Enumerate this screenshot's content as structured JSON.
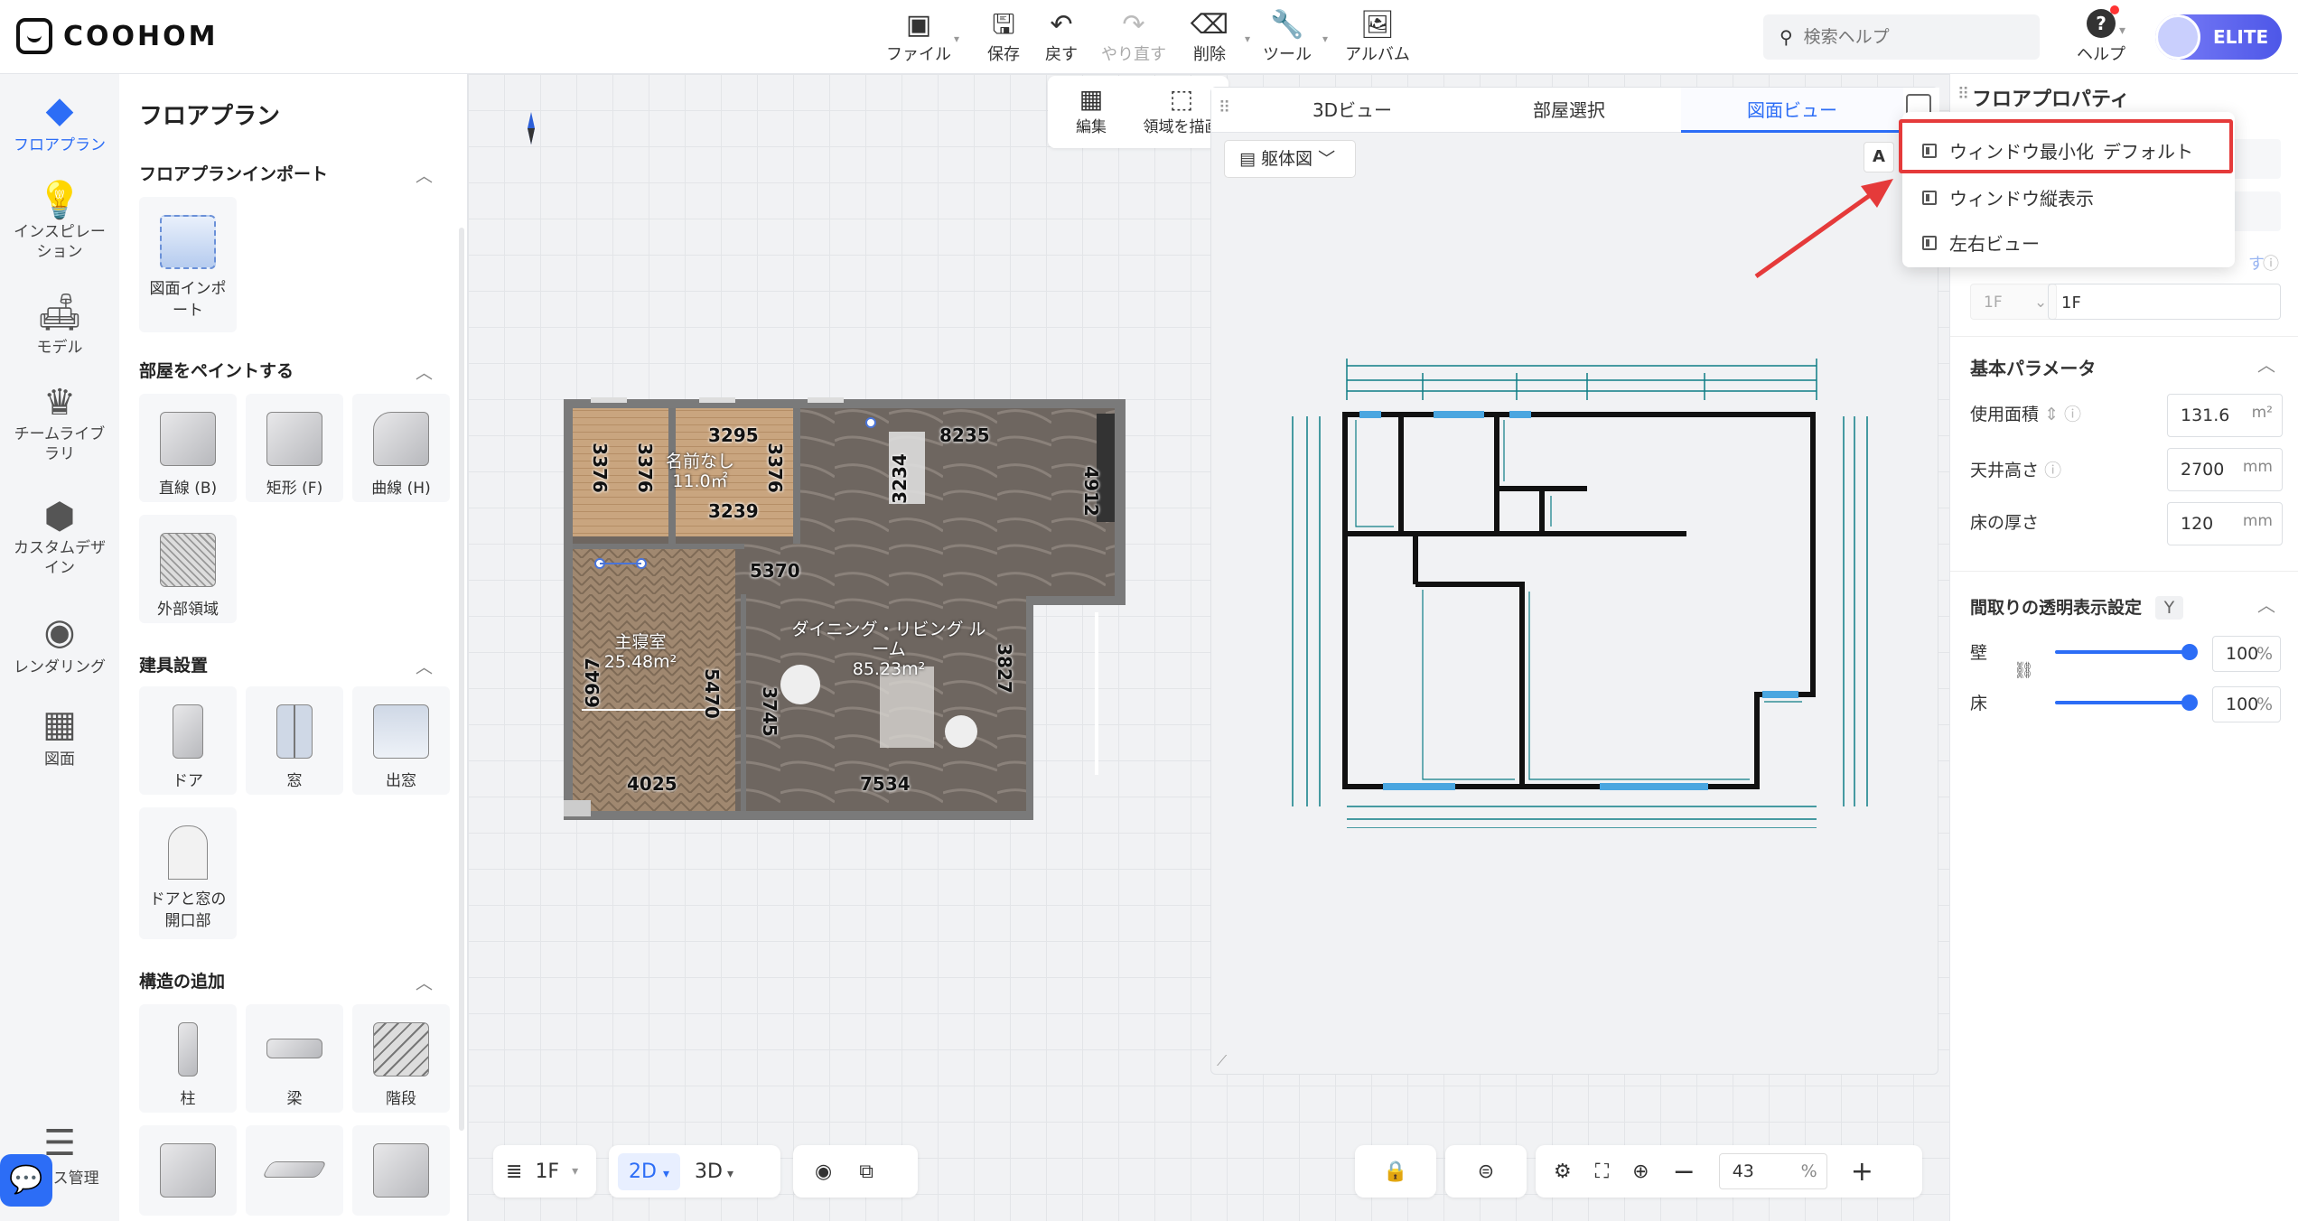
{
  "app": {
    "logo": "COOHOM",
    "badge": "ELITE"
  },
  "toolbar": [
    {
      "label": "ファイル",
      "icon": "file-icon",
      "has_caret": true
    },
    {
      "label": "保存",
      "icon": "save-icon"
    },
    {
      "label": "戻す",
      "icon": "undo-icon"
    },
    {
      "label": "やり直す",
      "icon": "redo-icon",
      "disabled": true
    },
    {
      "label": "削除",
      "icon": "eraser-icon",
      "has_caret": true
    },
    {
      "label": "ツール",
      "icon": "wrench-icon",
      "has_caret": true
    },
    {
      "label": "アルバム",
      "icon": "album-icon"
    }
  ],
  "search": {
    "placeholder": "検索ヘルプ"
  },
  "help_label": "ヘルプ",
  "leftnav": [
    {
      "label": "フロアプラン",
      "icon": "floorplan-icon",
      "active": true
    },
    {
      "label": "インスピレーション",
      "icon": "bulb-icon"
    },
    {
      "label": "モデル",
      "icon": "sofa-icon"
    },
    {
      "label": "チームライブラリ",
      "icon": "crown-icon"
    },
    {
      "label": "カスタムデザイン",
      "icon": "box-icon"
    },
    {
      "label": "レンダリング",
      "icon": "camera-icon"
    },
    {
      "label": "図面",
      "icon": "drawing-icon"
    },
    {
      "label": "ース管理",
      "icon": "manage-icon"
    }
  ],
  "catalog": {
    "title": "フロアプラン",
    "sections": [
      {
        "title": "フロアプランインポート",
        "items": [
          "図面インポート"
        ]
      },
      {
        "title": "部屋をペイントする",
        "items": [
          "直線 (B)",
          "矩形 (F)",
          "曲線 (H)",
          "外部領域"
        ]
      },
      {
        "title": "建具設置",
        "items": [
          "ドア",
          "窓",
          "出窓",
          "ドアと窓の開口部"
        ]
      },
      {
        "title": "構造の追加",
        "items": [
          "柱",
          "梁",
          "階段"
        ]
      }
    ]
  },
  "edit_tools": {
    "edit": "編集",
    "draw_area": "領域を描画"
  },
  "plan": {
    "dims": [
      "3295",
      "8235",
      "3376",
      "3376",
      "3376",
      "3239",
      "3234",
      "4912",
      "5370",
      "6947",
      "5470",
      "3745",
      "3827",
      "4025",
      "7534"
    ],
    "rooms": [
      {
        "name": "名前なし",
        "area": "11.0㎡"
      },
      {
        "name": "主寝室",
        "area": "25.48m²"
      },
      {
        "name": "ダイニング・リビング ルーム",
        "area": "85.23m²"
      }
    ]
  },
  "bottom": {
    "floor": "1F",
    "mode2d": "2D",
    "mode3d": "3D",
    "zoom": "43",
    "zoom_unit": "%"
  },
  "viewpanel": {
    "tabs": [
      "3Dビュー",
      "部屋選択",
      "図面ビュー"
    ],
    "active_tab": 2,
    "dropdown": "躯体図",
    "font_icon": "A"
  },
  "menu": {
    "items": [
      {
        "label": "ウィンドウ最小化",
        "tag": "デフォルト"
      },
      {
        "label": "ウィンドウ縦表示"
      },
      {
        "label": "左右ビュー"
      }
    ]
  },
  "props": {
    "title": "フロアプロパティ",
    "floor_select": "1F",
    "floor_name": "1F",
    "hidden_link": "す",
    "basic_title": "基本パラメータ",
    "area_label": "使用面積",
    "area_value": "131.6",
    "area_unit": "m²",
    "ceiling_label": "天井高さ",
    "ceiling_value": "2700",
    "ceiling_unit": "mm",
    "floor_thick_label": "床の厚さ",
    "floor_thick_value": "120",
    "floor_thick_unit": "mm",
    "transparency_title": "間取りの透明表示設定",
    "transparency_key": "Y",
    "wall_label": "壁",
    "wall_value": "100",
    "floor_label": "床",
    "floor_value": "100",
    "pct_unit": "%"
  },
  "colors": {
    "accent": "#2c6df6",
    "highlight": "#e53a3a",
    "drawing": "#0e7d85"
  }
}
